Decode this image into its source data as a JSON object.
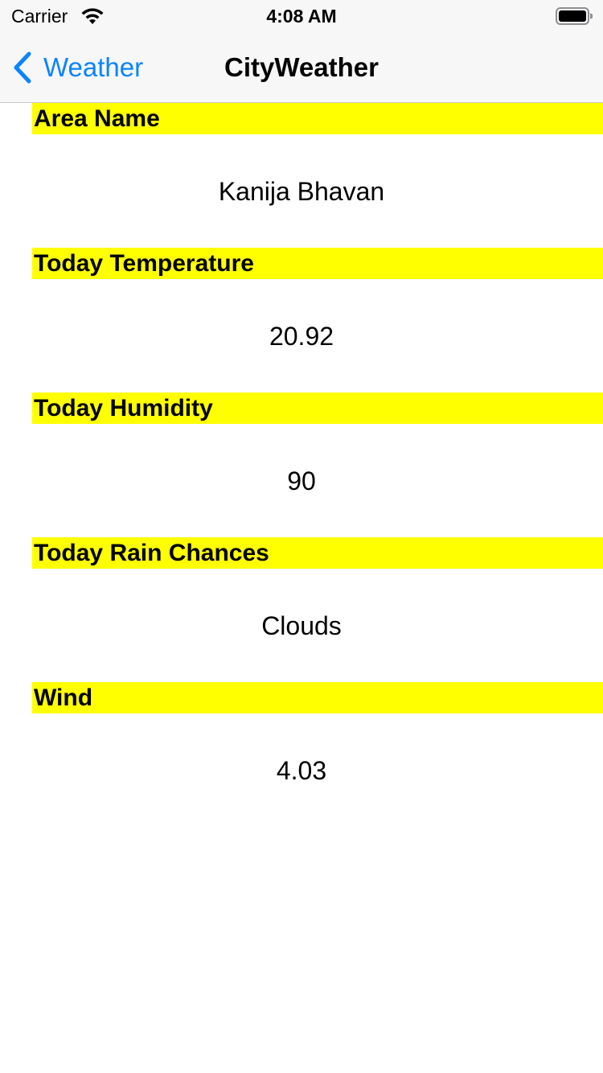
{
  "status_bar": {
    "carrier": "Carrier",
    "time": "4:08 AM"
  },
  "nav": {
    "back_label": "Weather",
    "title": "CityWeather"
  },
  "sections": [
    {
      "header": "Area Name",
      "value": "Kanija Bhavan"
    },
    {
      "header": "Today Temperature",
      "value": "20.92"
    },
    {
      "header": "Today Humidity",
      "value": "90"
    },
    {
      "header": "Today Rain Chances",
      "value": "Clouds"
    },
    {
      "header": "Wind",
      "value": "4.03"
    }
  ],
  "colors": {
    "accent": "#0a84ff",
    "header_highlight": "#ffff00",
    "bar_background": "#f7f7f7"
  },
  "icons": {
    "wifi": "wifi-icon",
    "battery": "battery-icon",
    "back": "chevron-left-icon"
  }
}
